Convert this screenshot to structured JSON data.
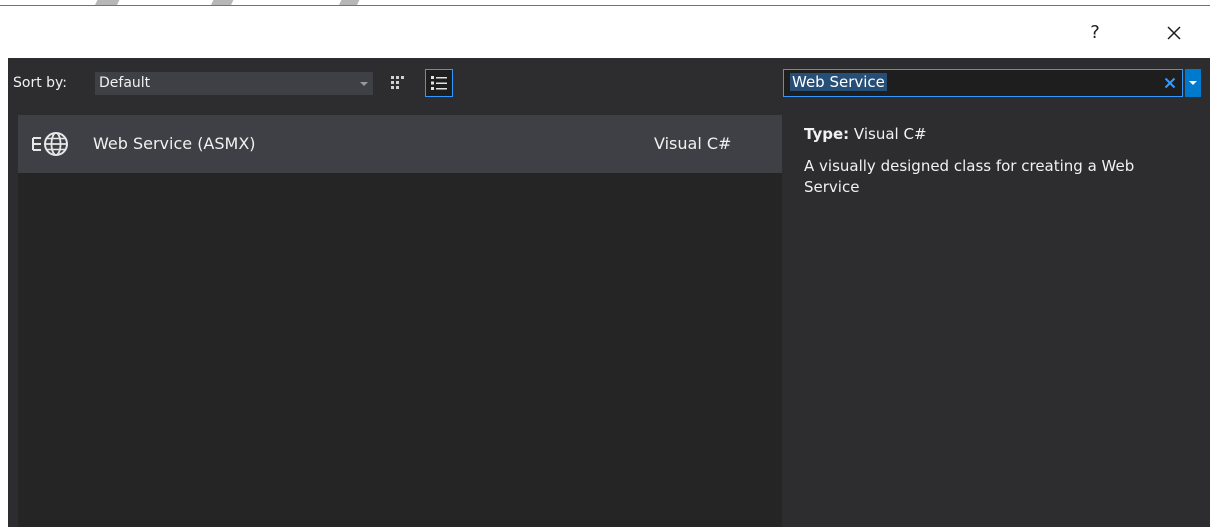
{
  "window": {
    "help_label": "?",
    "close_icon": "close-icon"
  },
  "sort": {
    "label": "Sort by:",
    "value": "Default"
  },
  "view_buttons": {
    "small_icons": "small-icons-view-icon",
    "list": "list-view-icon"
  },
  "search": {
    "value": "Web Service"
  },
  "templates": [
    {
      "name": "Web Service (ASMX)",
      "language": "Visual C#",
      "icon": "web-service-globe-icon"
    }
  ],
  "details": {
    "type_label": "Type:",
    "type_value": "Visual C#",
    "description": "A visually designed class for creating a Web Service"
  },
  "colors": {
    "background": "#2d2d30",
    "list_background": "#252526",
    "selected_row": "#3f3f46",
    "accent": "#3399ff",
    "dropdown_accent": "#007acc"
  }
}
